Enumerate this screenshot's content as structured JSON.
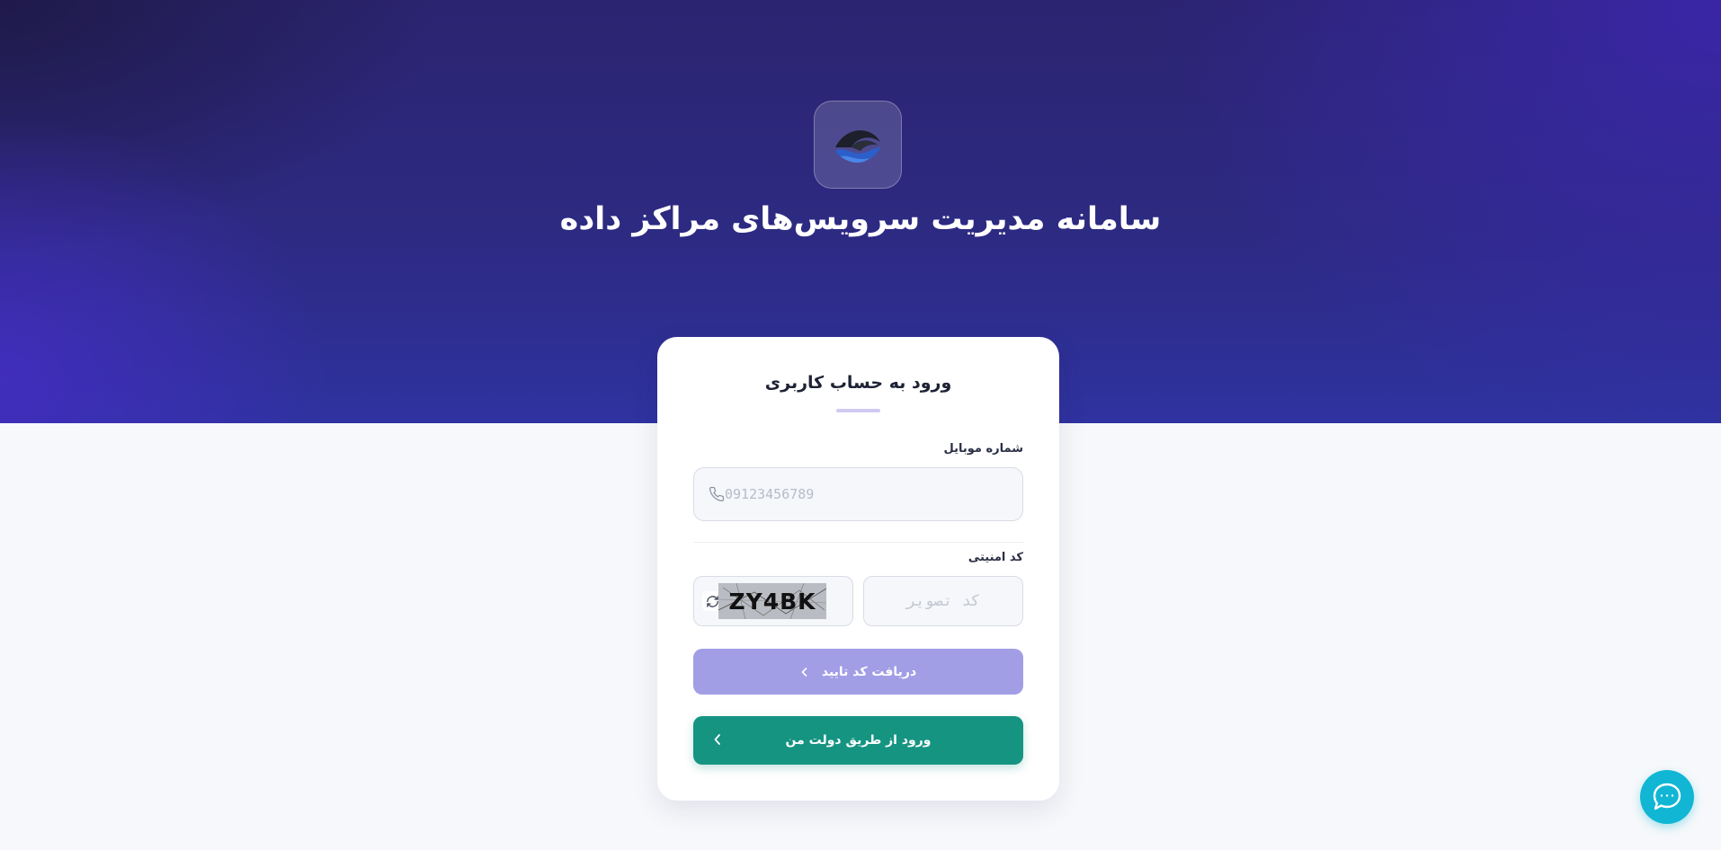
{
  "header": {
    "title": "سامانه مدیریت سرویس‌های مراکز داده",
    "logo_icon": "wave-logo-icon"
  },
  "login_card": {
    "title": "ورود به حساب کاربری",
    "phone": {
      "label": "شماره موبایل",
      "placeholder": "09123456789",
      "value": "",
      "icon": "phone-icon"
    },
    "captcha": {
      "label": "کد امنیتی",
      "image_text": "ZY4BK",
      "input_placeholder": "کد تصویر",
      "input_value": "",
      "refresh_icon": "refresh-icon"
    },
    "get_code_button": "دریافت کد تایید",
    "gov_login_button": "ورود از طریق دولت من"
  },
  "chat_widget": {
    "icon": "chat-bubble-icon"
  },
  "colors": {
    "hero_gradient_dark": "#2b2470",
    "hero_gradient_accent": "#3a2ec2",
    "primary_button_disabled": "#a19ee6",
    "gov_button": "#159482",
    "chat_button": "#10b6d4",
    "page_background": "#f6f8fb"
  }
}
